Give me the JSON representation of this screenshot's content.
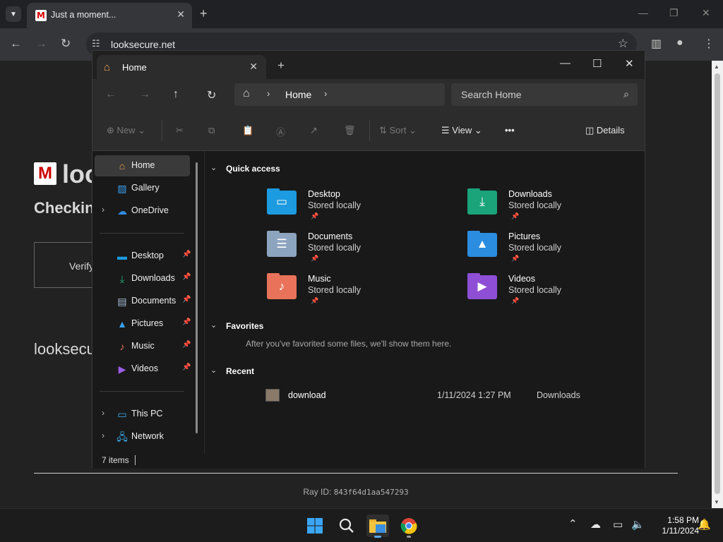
{
  "browser": {
    "tab_title": "Just a moment...",
    "tab_favicon": "M",
    "url": "looksecure.net",
    "tab_search_icon": "chevron-down-icon",
    "newtab_label": "+"
  },
  "page": {
    "logo_letter": "M",
    "site_name": "loo",
    "checking_text": "Checkin",
    "verify_text": "Verify",
    "site_name_2": "looksecu",
    "ray_label": "Ray ID:",
    "ray_value": "843f64d1aa547293"
  },
  "explorer": {
    "tab_title": "Home",
    "breadcrumb": "Home",
    "search_placeholder": "Search Home",
    "commands": {
      "new": "New",
      "sort": "Sort",
      "view": "View",
      "details": "Details",
      "more": "•••"
    },
    "nav": {
      "home": "Home",
      "gallery": "Gallery",
      "onedrive": "OneDrive",
      "desktop": "Desktop",
      "downloads": "Downloads",
      "documents": "Documents",
      "pictures": "Pictures",
      "music": "Music",
      "videos": "Videos",
      "this_pc": "This PC",
      "network": "Network"
    },
    "quick_access_title": "Quick access",
    "quick_access": [
      {
        "name": "Desktop",
        "status": "Stored locally",
        "color": "#1c9be0"
      },
      {
        "name": "Downloads",
        "status": "Stored locally",
        "color": "#1ba37a"
      },
      {
        "name": "Documents",
        "status": "Stored locally",
        "color": "#8da4bf"
      },
      {
        "name": "Pictures",
        "status": "Stored locally",
        "color": "#2a8de0"
      },
      {
        "name": "Music",
        "status": "Stored locally",
        "color": "#e8735a"
      },
      {
        "name": "Videos",
        "status": "Stored locally",
        "color": "#8e4fd6"
      }
    ],
    "favorites_title": "Favorites",
    "favorites_note": "After you've favorited some files, we'll show them here.",
    "recent_title": "Recent",
    "recent": [
      {
        "name": "download",
        "date": "1/11/2024 1:27 PM",
        "location": "Downloads"
      }
    ],
    "status_items": "7 items"
  },
  "taskbar": {
    "time": "1:58 PM",
    "date": "1/11/2024"
  }
}
